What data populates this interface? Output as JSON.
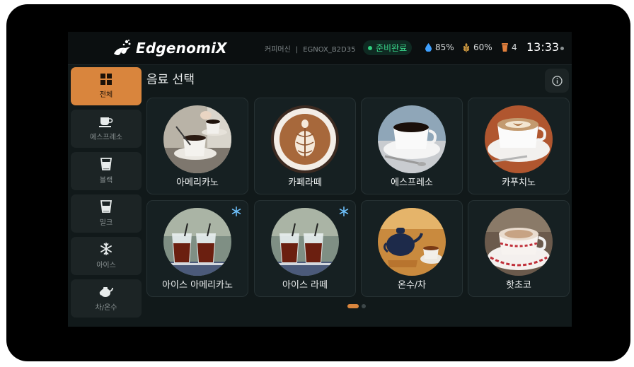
{
  "app": {
    "brand": "EdgenomiX",
    "device_type": "커피머신",
    "device_id": "EGNOX_B2D35",
    "status": "준비완료",
    "water_level": "85%",
    "bean_level": "60%",
    "cup_count": "4",
    "time": "13:33"
  },
  "sidebar": {
    "items": [
      {
        "label": "전체",
        "icon": "grid-icon",
        "active": true
      },
      {
        "label": "에스프레소",
        "icon": "espresso-cup-icon",
        "active": false
      },
      {
        "label": "블랙",
        "icon": "black-cup-icon",
        "active": false
      },
      {
        "label": "밀크",
        "icon": "milk-cup-icon",
        "active": false
      },
      {
        "label": "아이스",
        "icon": "snowflake-icon",
        "active": false
      },
      {
        "label": "차/온수",
        "icon": "teapot-icon",
        "active": false
      }
    ]
  },
  "main": {
    "title": "음료 선택",
    "drinks": [
      {
        "name": "아메리카노",
        "iced": false
      },
      {
        "name": "카페라떼",
        "iced": false
      },
      {
        "name": "에스프레소",
        "iced": false
      },
      {
        "name": "카푸치노",
        "iced": false
      },
      {
        "name": "아이스 아메리카노",
        "iced": true
      },
      {
        "name": "아이스 라떼",
        "iced": true
      },
      {
        "name": "온수/차",
        "iced": false
      },
      {
        "name": "핫초코",
        "iced": false
      }
    ],
    "page_current": 1,
    "page_total": 2
  },
  "colors": {
    "accent": "#d9853d",
    "status_green": "#39d68a",
    "ice_blue": "#6fc3ff",
    "background": "#11191a"
  }
}
